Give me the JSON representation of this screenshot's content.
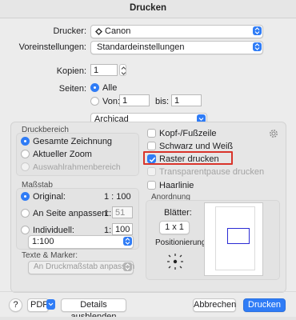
{
  "dialog": {
    "title": "Drucken"
  },
  "printer": {
    "label": "Drucker:",
    "value": "Canon"
  },
  "presets": {
    "label": "Voreinstellungen:",
    "value": "Standardeinstellungen"
  },
  "copies": {
    "label": "Kopien:",
    "value": "1"
  },
  "pages": {
    "label": "Seiten:",
    "all_label": "Alle",
    "from_label": "Von:",
    "from_value": "1",
    "to_label": "bis:",
    "to_value": "1",
    "selected": "Alle"
  },
  "app_menu": {
    "value": "Archicad"
  },
  "print_area": {
    "header": "Druckbereich",
    "options": [
      "Gesamte Zeichnung",
      "Aktueller Zoom",
      "Auswahlrahmenbereich"
    ],
    "selected": "Gesamte Zeichnung"
  },
  "scale": {
    "header": "Maßstab",
    "original_label": "Original:",
    "original_value": "1 : 100",
    "fit_label": "An Seite anpassen:",
    "fit_prefix": "1:",
    "fit_value": "51",
    "custom_label": "Individuell:",
    "custom_prefix": "1:",
    "custom_value": "100",
    "preset_value": "1:100",
    "selected": "Original:"
  },
  "text_marker": {
    "header": "Texte & Marker:",
    "value": "An Druckmaßstab anpassen"
  },
  "options": {
    "header_footer": {
      "label": "Kopf-/Fußzeile",
      "checked": false
    },
    "black_white": {
      "label": "Schwarz und Weiß",
      "checked": false
    },
    "print_grid": {
      "label": "Raster drucken",
      "checked": true
    },
    "transparent_pause": {
      "label": "Transparentpause drucken",
      "checked": false,
      "disabled": true
    },
    "hairline": {
      "label": "Haarlinie",
      "checked": false
    }
  },
  "arrangement": {
    "header": "Anordnung",
    "sheets_label": "Blätter:",
    "sheets_value": "1 x 1",
    "position_label": "Positionierung:"
  },
  "footer": {
    "help_label": "?",
    "pdf_label": "PDF",
    "hide_details_label": "Details ausblenden",
    "cancel_label": "Abbrechen",
    "print_label": "Drucken"
  },
  "colors": {
    "accent": "#2f7cf6",
    "highlight": "#d9342a",
    "preview_rect": "#2b2bd4"
  }
}
